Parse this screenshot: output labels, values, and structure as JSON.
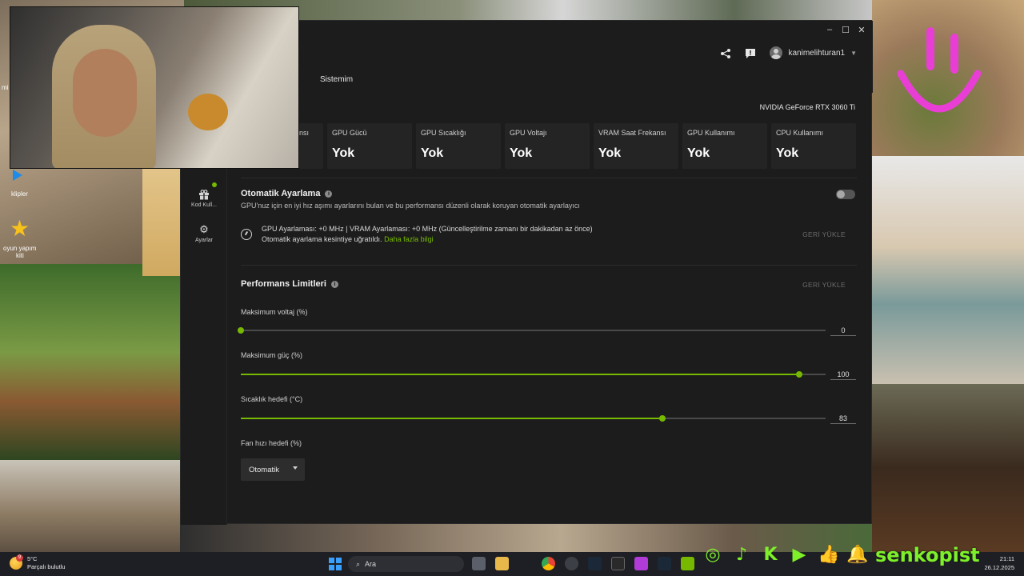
{
  "overlay": {
    "left_labels": [
      "mi",
      "klipler",
      "oyun yapım",
      "kiti"
    ]
  },
  "app": {
    "user": {
      "name": "kanimelihturan1"
    },
    "tabs": [
      "Sistemim"
    ],
    "nav": [
      {
        "label": "Kod Kull...",
        "icon": "gift-icon"
      },
      {
        "label": "Ayarlar",
        "icon": "gear-icon"
      }
    ],
    "gpu_model": "NVIDIA GeForce RTX 3060 Ti",
    "stats": [
      {
        "label": "nsı",
        "value": ""
      },
      {
        "label": "GPU Gücü",
        "value": "Yok"
      },
      {
        "label": "GPU Sıcaklığı",
        "value": "Yok"
      },
      {
        "label": "GPU Voltajı",
        "value": "Yok"
      },
      {
        "label": "VRAM Saat Frekansı",
        "value": "Yok"
      },
      {
        "label": "GPU Kullanımı",
        "value": "Yok"
      },
      {
        "label": "CPU Kullanımı",
        "value": "Yok"
      }
    ],
    "auto_tuning": {
      "title": "Otomatik Ayarlama",
      "description": "GPU'nuz için en iyi hız aşımı ayarlarını bulan ve bu performansı düzenli olarak koruyan otomatik ayarlayıcı",
      "toggle_on": false,
      "status_line": "GPU Ayarlaması: +0 MHz   |  VRAM Ayarlaması: +0 MHz (Güncelleştirilme zamanı bir dakikadan az önce)",
      "interrupted_text": "Otomatik ayarlama kesintiye uğratıldı.",
      "learn_more": "Daha fazla bilgi",
      "restore": "GERİ YÜKLE"
    },
    "perf_limits": {
      "title": "Performans Limitleri",
      "restore": "GERİ YÜKLE",
      "sliders": [
        {
          "label": "Maksimum voltaj (%)",
          "value": "0",
          "fraction": 0.0
        },
        {
          "label": "Maksimum güç (%)",
          "value": "100",
          "fraction": 0.955
        },
        {
          "label": "Sıcaklık hedefi (°C)",
          "value": "83",
          "fraction": 0.721
        }
      ],
      "fan": {
        "label": "Fan hızı hedefi (%)",
        "selected": "Otomatik"
      }
    }
  },
  "taskbar": {
    "weather": {
      "temp": "5°C",
      "desc": "Parçalı bulutlu",
      "badge": "9"
    },
    "search_placeholder": "Ara",
    "time": "21:11",
    "date": "26.12.2025"
  },
  "social": {
    "handle": "senkopist"
  },
  "colors": {
    "accent": "#76b900",
    "social_green": "#7ef02a",
    "smiley": "#e83ed6"
  }
}
